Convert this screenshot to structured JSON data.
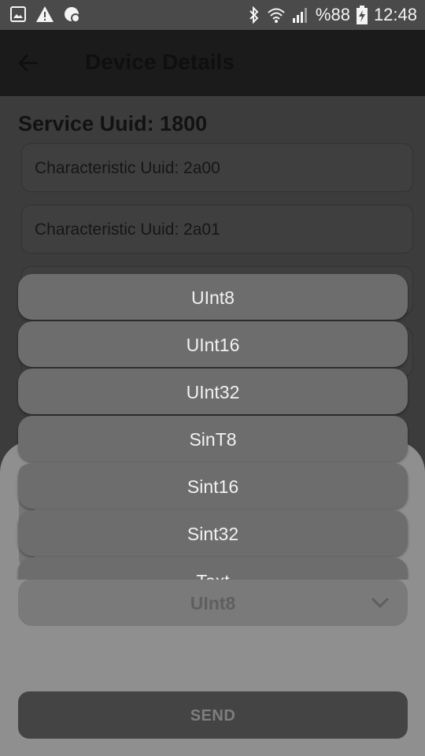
{
  "status_bar": {
    "battery": "%88",
    "time": "12:48",
    "icons": [
      "image-icon",
      "warning-icon",
      "data-saver-icon",
      "bluetooth-icon",
      "wifi-icon",
      "signal-icon",
      "battery-charging-icon"
    ]
  },
  "app_bar": {
    "title": "Device Details",
    "back_icon": "arrow-left-icon"
  },
  "service": {
    "title": "Service Uuid: 1800",
    "characteristics": [
      "Characteristic Uuid: 2a00",
      "Characteristic Uuid: 2a01"
    ]
  },
  "dropdown": {
    "options": [
      "UInt8",
      "UInt16",
      "UInt32",
      "SinT8",
      "Sint16",
      "Sint32",
      "Text"
    ]
  },
  "select": {
    "value": "UInt8",
    "chevron_icon": "chevron-down-icon"
  },
  "send_button": {
    "label": "SEND"
  },
  "colors": {
    "overlay_bg": "#3c3c3c",
    "sheet_bg": "#8f8f8f",
    "option_bg": "#6d6d6d",
    "send_bg": "#444444"
  }
}
